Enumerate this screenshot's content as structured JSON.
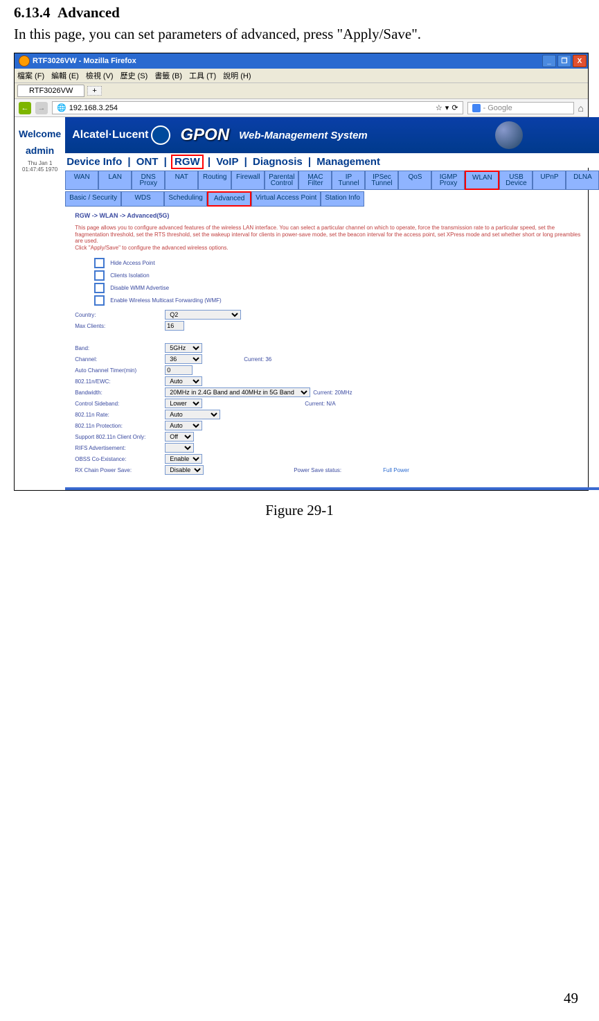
{
  "doc": {
    "section_no": "6.13.4",
    "section_title": "Advanced",
    "intro": "In this page, you can set parameters of advanced, press \"Apply/Save\".",
    "caption": "Figure 29-1",
    "page_number": "49"
  },
  "titlebar": {
    "text": "RTF3026VW - Mozilla Firefox"
  },
  "winbtns": {
    "min": "_",
    "max": "❐",
    "close": "X"
  },
  "menubar": [
    "檔案 (F)",
    "編輯 (E)",
    "檢視 (V)",
    "歷史 (S)",
    "書籤 (B)",
    "工具 (T)",
    "說明 (H)"
  ],
  "tab": {
    "label": "RTF3026VW",
    "plus": "+"
  },
  "nav": {
    "back": "←",
    "fwd": "→",
    "url": "192.168.3.254",
    "star": "☆",
    "ref": "⟳",
    "search_prefix": "- Google",
    "home": "⌂"
  },
  "banner": {
    "brand": "Alcatel·Lucent",
    "gpon": "GPON",
    "wms": "Web-Management System"
  },
  "sidebar": {
    "welcome": "Welcome",
    "admin": "admin",
    "ts": "Thu Jan 1 01:47:45 1970"
  },
  "toptabs": {
    "items": [
      "Device Info",
      "ONT",
      "RGW",
      "VoIP",
      "Diagnosis",
      "Management"
    ],
    "sep": " | "
  },
  "tabs1": [
    "WAN",
    "LAN",
    "DNS\nProxy",
    "NAT",
    "Routing",
    "Firewall",
    "Parental\nControl",
    "MAC\nFilter",
    "IP\nTunnel",
    "IPSec\nTunnel",
    "QoS",
    "IGMP\nProxy",
    "WLAN",
    "USB\nDevice",
    "UPnP",
    "DLNA"
  ],
  "tabs2": [
    "Basic /\nSecurity",
    "WDS",
    "Scheduling",
    "Advanced",
    "Virtual Access\nPoint",
    "Station\nInfo"
  ],
  "bc": "RGW -> WLAN -> Advanced(5G)",
  "desc": "This page allows you to configure advanced features of the wireless LAN interface. You can select a particular channel on which to operate, force the transmission rate to a particular speed, set the fragmentation threshold, set the RTS threshold, set the wakeup interval for clients in power-save mode, set the beacon interval for the access point, set XPress mode and set whether short or long preambles are used.\nClick \"Apply/Save\" to configure the advanced wireless options.",
  "checks": [
    "Hide Access Point",
    "Clients Isolation",
    "Disable WMM Advertise",
    "Enable Wireless Multicast Forwarding (WMF)"
  ],
  "f": {
    "country_l": "Country:",
    "country_v": "Q2",
    "max_l": "Max Clients:",
    "max_v": "16",
    "band_l": "Band:",
    "band_v": "5GHz",
    "chan_l": "Channel:",
    "chan_v": "36",
    "chan_cur": "Current: 36",
    "act_l": "Auto Channel Timer(min)",
    "act_v": "0",
    "bwc_l": "802.11n/EWC:",
    "bwc_v": "Auto",
    "bw_l": "Bandwidth:",
    "bw_v": "20MHz in 2.4G Band and 40MHz in 5G Band",
    "bw_cur": "Current: 20MHz",
    "side_l": "Control Sideband:",
    "side_v": "Lower",
    "side_cur": "Current: N/A",
    "rate_l": "802.11n Rate:",
    "rate_v": "Auto",
    "prot_l": "802.11n Protection:",
    "prot_v": "Auto",
    "supp_l": "Support 802.11n Client Only:",
    "supp_v": "Off",
    "rifs_l": "RIFS Advertisement:",
    "rifs_v": "",
    "obss_l": "OBSS Co-Existance:",
    "obss_v": "Enable",
    "rx_l": "RX Chain Power Save:",
    "rx_v": "Disable",
    "rx_st": "Power Save status:",
    "rx_fp": "Full Power"
  }
}
